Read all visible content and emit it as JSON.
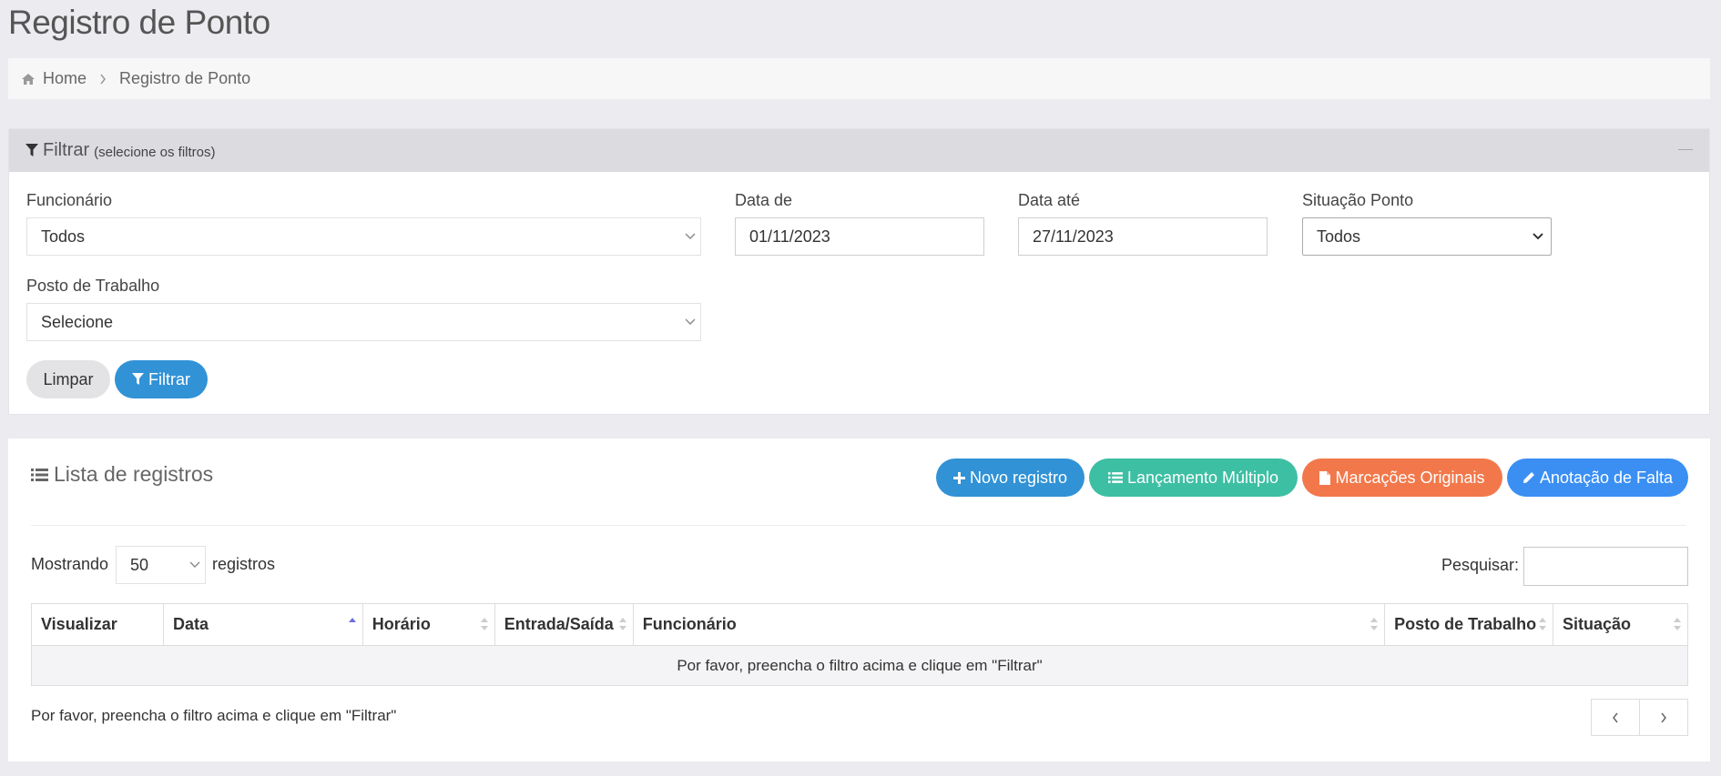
{
  "page": {
    "title": "Registro de Ponto"
  },
  "breadcrumb": {
    "home": "Home",
    "current": "Registro de Ponto"
  },
  "filter": {
    "title": "Filtrar",
    "hint": "(selecione os filtros)",
    "funcionario": {
      "label": "Funcionário",
      "value": "Todos"
    },
    "data_de": {
      "label": "Data de",
      "value": "01/11/2023"
    },
    "data_ate": {
      "label": "Data até",
      "value": "27/11/2023"
    },
    "situacao": {
      "label": "Situação Ponto",
      "value": "Todos"
    },
    "posto": {
      "label": "Posto de Trabalho",
      "value": "Selecione"
    },
    "clear_label": "Limpar",
    "filter_label": "Filtrar"
  },
  "list": {
    "title": "Lista de registros",
    "buttons": {
      "novo": "Novo registro",
      "multiplo": "Lançamento Múltiplo",
      "originais": "Marcações Originais",
      "falta": "Anotação de Falta"
    },
    "length": {
      "prefix": "Mostrando",
      "value": "50",
      "suffix": "registros"
    },
    "search_label": "Pesquisar:",
    "columns": [
      "Visualizar",
      "Data",
      "Horário",
      "Entrada/Saída",
      "Funcionário",
      "Posto de Trabalho",
      "Situação"
    ],
    "empty_message": "Por favor, preencha o filtro acima e clique em \"Filtrar\"",
    "info": "Por favor, preencha o filtro acima e clique em \"Filtrar\""
  },
  "colors": {
    "primary": "#3192d6",
    "teal": "#3dbfa3",
    "orange": "#f2784b",
    "light_blue": "#3b8ff3"
  }
}
